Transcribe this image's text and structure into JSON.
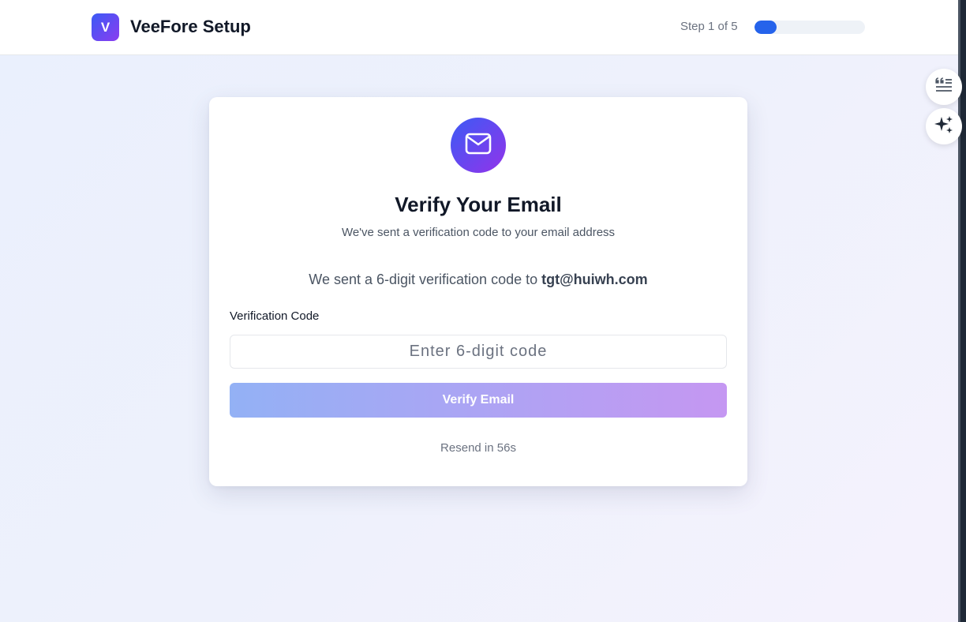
{
  "header": {
    "logo_letter": "V",
    "app_title": "VeeFore Setup",
    "step_text": "Step 1 of 5",
    "progress_fraction": 0.2,
    "accent_color": "#2563eb"
  },
  "side_tools": [
    {
      "icon": "quote-list-icon"
    },
    {
      "icon": "sparkles-icon"
    }
  ],
  "card": {
    "icon": "mail-icon",
    "title": "Verify Your Email",
    "subtitle": "We've sent a verification code to your email address",
    "sent_prefix": "We sent a 6-digit verification code to",
    "email": "tgt@huiwh.com",
    "field_label": "Verification Code",
    "input_value": "",
    "input_placeholder": "Enter 6-digit code",
    "button_label": "Verify Email",
    "resend_text": "Resend in 56s"
  }
}
